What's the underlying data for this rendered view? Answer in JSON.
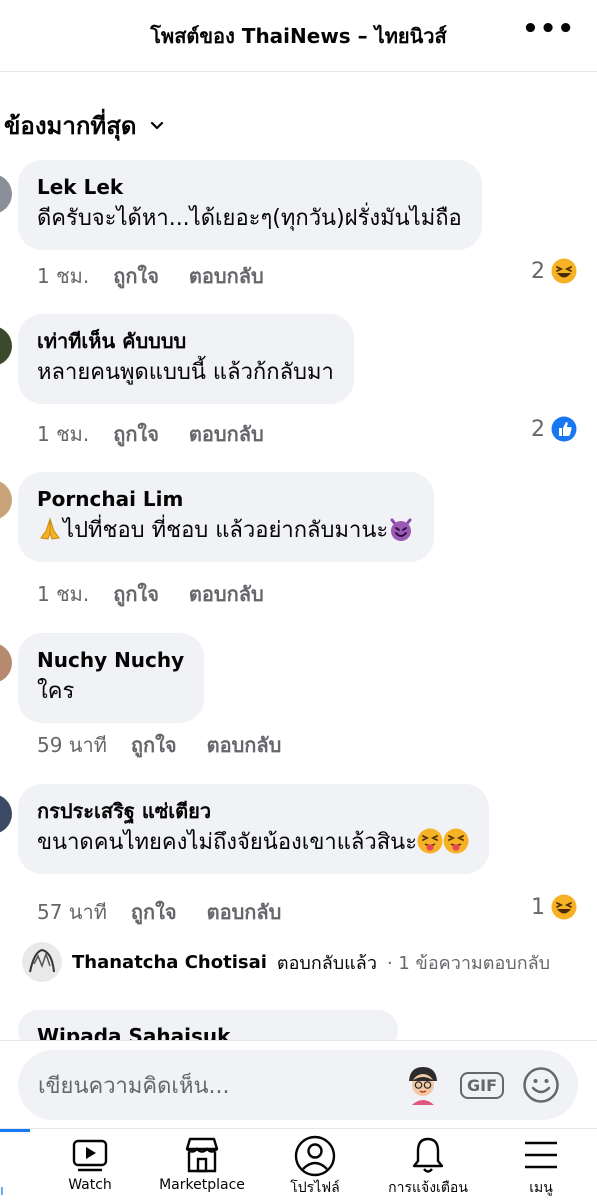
{
  "header": {
    "title": "โพสต์ของ ThaiNews – ไทยนิวส์",
    "more_label": "•••"
  },
  "sort": {
    "label": "ข้องมากที่สุด"
  },
  "comments": [
    {
      "author": "Lek Lek",
      "text": "ดีครับจะได้หา...ได้เยอะๆ(ทุกวัน)ฝรั่งมันไม่ถือ",
      "text_emojis": [],
      "lead_emoji": "",
      "time": "1 ชม.",
      "like_label": "ถูกใจ",
      "reply_label": "ตอบกลับ",
      "reaction_count": "2",
      "reaction_type": "haha-icon"
    },
    {
      "author": "เท่าทีเห็น คับบบบ",
      "text": "หลายคนพูดแบบนี้ แล้วก้กลับมา",
      "text_emojis": [],
      "lead_emoji": "",
      "time": "1 ชม.",
      "like_label": "ถูกใจ",
      "reply_label": "ตอบกลับ",
      "reaction_count": "2",
      "reaction_type": "like-icon"
    },
    {
      "author": "Pornchai Lim",
      "text": "ไปที่ชอบ ที่ชอบ แล้วอย่ากลับมานะ",
      "lead_emoji": "folded-hands-emoji",
      "text_emojis": [
        "smiling-devil-emoji"
      ],
      "time": "1 ชม.",
      "like_label": "ถูกใจ",
      "reply_label": "ตอบกลับ",
      "reaction_count": "",
      "reaction_type": ""
    },
    {
      "author": "Nuchy Nuchy",
      "text": "ใคร",
      "text_emojis": [],
      "lead_emoji": "",
      "time": "59 นาที",
      "like_label": "ถูกใจ",
      "reply_label": "ตอบกลับ",
      "reaction_count": "",
      "reaction_type": ""
    },
    {
      "author": "กรประเสริฐ แซ่เตียว",
      "text": "ขนาดคนไทยคงไม่ถึงจัยน้องเขาแล้วสินะ",
      "text_emojis": [
        "tongue-squint-emoji",
        "tongue-squint-emoji"
      ],
      "lead_emoji": "",
      "time": "57 นาที",
      "like_label": "ถูกใจ",
      "reply_label": "ตอบกลับ",
      "reaction_count": "1",
      "reaction_type": "haha-icon"
    }
  ],
  "reply_thread": {
    "name": "Thanatcha Chotisai",
    "action": "ตอบกลับแล้ว",
    "count": "· 1 ข้อความตอบกลับ"
  },
  "partial_comment": {
    "author": "Wipada Sahaisuk"
  },
  "composer": {
    "placeholder": "เขียนความคิดเห็น...",
    "gif_label": "GIF"
  },
  "bottom_nav": {
    "items": [
      {
        "label": "Watch",
        "icon": "watch-icon"
      },
      {
        "label": "Marketplace",
        "icon": "marketplace-icon"
      },
      {
        "label": "โปรไฟล์",
        "icon": "profile-icon"
      },
      {
        "label": "การแจ้งเตือน",
        "icon": "bell-icon"
      },
      {
        "label": "เมนู",
        "icon": "menu-icon"
      }
    ],
    "edge_label": "ı"
  },
  "colors": {
    "accent": "#1877f2",
    "bubble": "#f0f2f5",
    "muted": "#65676b",
    "emoji_yellow": "#f7b125"
  }
}
